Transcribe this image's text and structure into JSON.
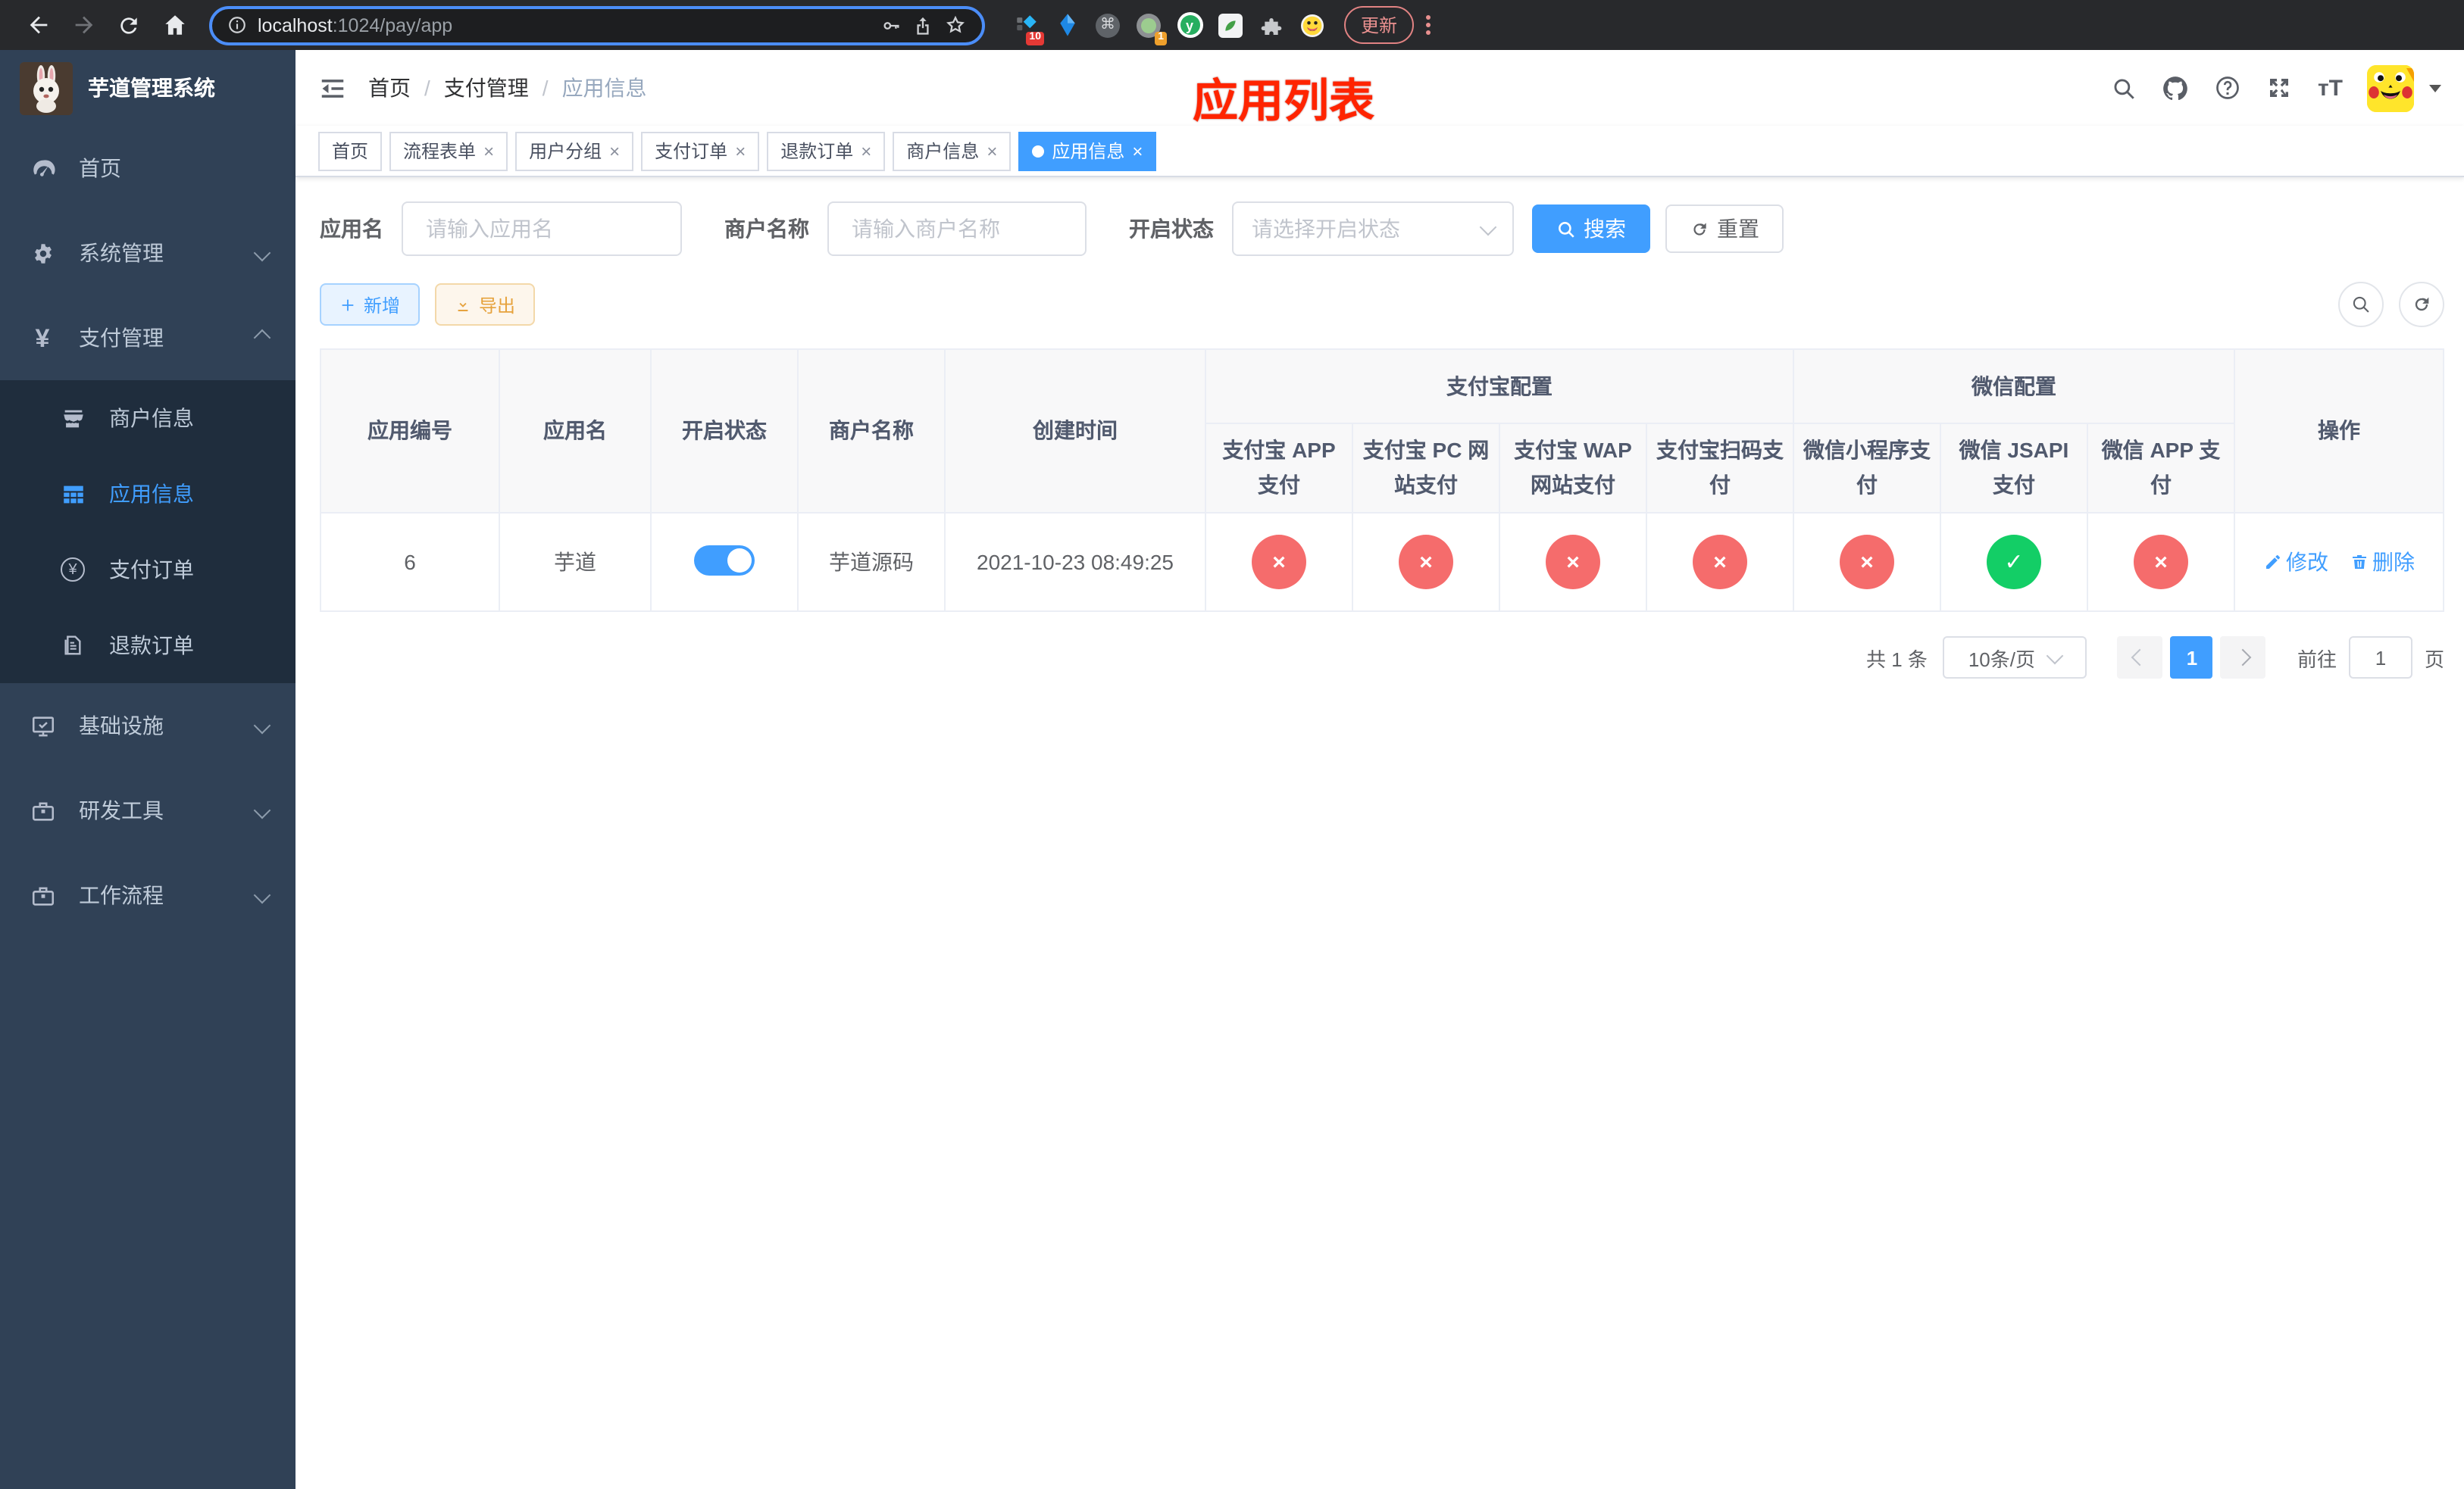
{
  "browser": {
    "url_host": "localhost",
    "url_rest": ":1024/pay/app",
    "update_label": "更新",
    "ext_badge_a": "10",
    "ext_badge_b": "1",
    "cmd_glyph": "⌘",
    "y_glyph": "y"
  },
  "sidebar": {
    "title": "芋道管理系统",
    "items": [
      {
        "label": "首页"
      },
      {
        "label": "系统管理"
      },
      {
        "label": "支付管理"
      },
      {
        "label": "基础设施"
      },
      {
        "label": "研发工具"
      },
      {
        "label": "工作流程"
      }
    ],
    "pay_submenu": [
      {
        "label": "商户信息"
      },
      {
        "label": "应用信息"
      },
      {
        "label": "支付订单"
      },
      {
        "label": "退款订单"
      }
    ],
    "yen_glyph": "¥"
  },
  "navbar": {
    "breadcrumb": {
      "home": "首页",
      "section": "支付管理",
      "current": "应用信息"
    },
    "annotation": "应用列表",
    "font_size_glyph": "тT"
  },
  "tags": {
    "items": [
      {
        "label": "首页"
      },
      {
        "label": "流程表单"
      },
      {
        "label": "用户分组"
      },
      {
        "label": "支付订单"
      },
      {
        "label": "退款订单"
      },
      {
        "label": "商户信息"
      },
      {
        "label": "应用信息"
      }
    ]
  },
  "filters": {
    "app_name_label": "应用名",
    "app_name_placeholder": "请输入应用名",
    "merchant_label": "商户名称",
    "merchant_placeholder": "请输入商户名称",
    "status_label": "开启状态",
    "status_placeholder": "请选择开启状态",
    "search_label": "搜索",
    "reset_label": "重置"
  },
  "toolbar": {
    "add_label": "新增",
    "export_label": "导出"
  },
  "table": {
    "columns": {
      "app_id": "应用编号",
      "app_name": "应用名",
      "status": "开启状态",
      "merchant": "商户名称",
      "created": "创建时间",
      "actions": "操作"
    },
    "groups": {
      "alipay": "支付宝配置",
      "wechat": "微信配置"
    },
    "sub": [
      "支付宝 APP 支付",
      "支付宝 PC 网站支付",
      "支付宝 WAP 网站支付",
      "支付宝扫码支付",
      "微信小程序支付",
      "微信 JSAPI 支付",
      "微信 APP 支付"
    ],
    "row": {
      "app_id": "6",
      "app_name": "芋道",
      "enabled": true,
      "merchant": "芋道源码",
      "created": "2021-10-23 08:49:25",
      "channels": [
        "fail",
        "fail",
        "fail",
        "fail",
        "fail",
        "success",
        "fail"
      ],
      "edit_label": "修改",
      "delete_label": "删除"
    }
  },
  "pagination": {
    "total": "共 1 条",
    "page_size": "10条/页",
    "current_page": "1",
    "goto_label": "前往",
    "goto_value": "1",
    "page_unit": "页"
  },
  "colors": {
    "accent": "#409eff",
    "danger": "#f56c6c",
    "success": "#13ce66",
    "annotation": "#ff2400",
    "sidebar_bg": "#304156",
    "submenu_bg": "#1f2d3d"
  }
}
